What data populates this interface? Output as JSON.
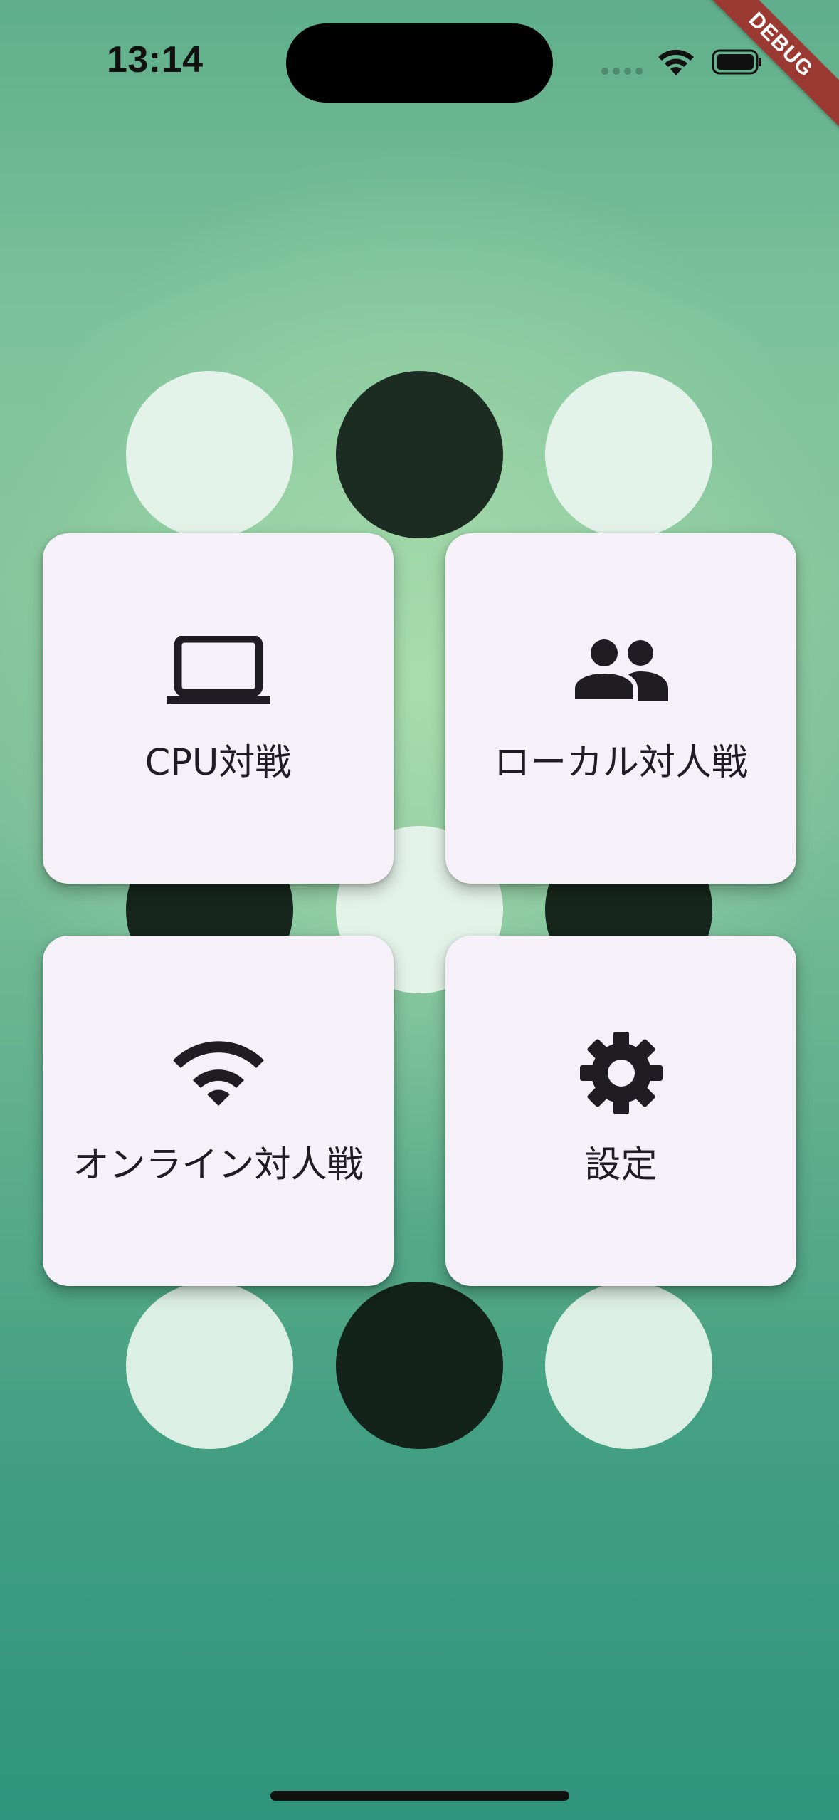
{
  "status_bar": {
    "time": "13:14"
  },
  "debug_banner": {
    "label": "DEBUG"
  },
  "menu": {
    "cpu": {
      "label": "CPU対戦",
      "icon": "laptop-icon"
    },
    "local": {
      "label": "ローカル対人戦",
      "icon": "people-icon"
    },
    "online": {
      "label": "オンライン対人戦",
      "icon": "wifi-icon"
    },
    "settings": {
      "label": "設定",
      "icon": "gear-icon"
    }
  },
  "colors": {
    "background_top": "#5fae8c",
    "background_bottom": "#2f947b",
    "card": "#f6f1f8",
    "disc_light": "#e4f3ea",
    "disc_dark": "#1d2c22",
    "debug_banner": "#9b3a32"
  }
}
